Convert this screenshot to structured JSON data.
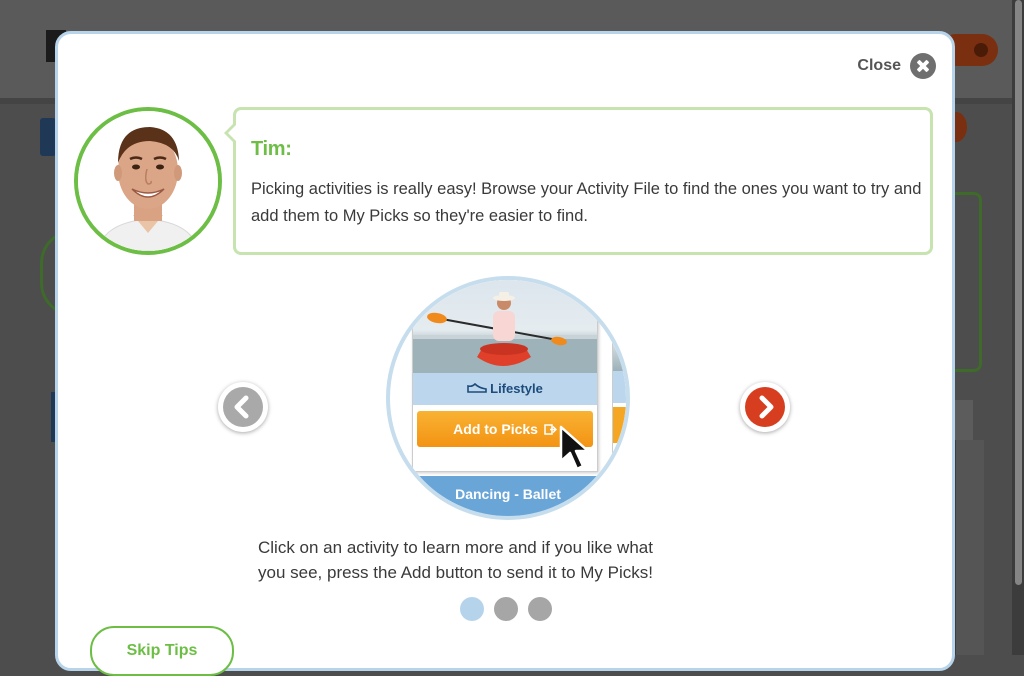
{
  "modal": {
    "close_label": "Close",
    "speaker": "Tim:",
    "speech": "Picking activities is really easy! Browse your Activity File to find the ones you want to try and add them to My Picks so they're easier to find.",
    "illustration": {
      "category_label": "Lifestyle",
      "add_button_label": "Add to Picks",
      "next_card_label": "Dancing - Ballet"
    },
    "caption_line1": "Click on an activity to learn more and if you like what",
    "caption_line2": "you see, press the Add button to send it to My Picks!",
    "pagination": {
      "total": 3,
      "active_index": 0
    },
    "skip_label": "Skip Tips"
  },
  "colors": {
    "accent_green": "#6cbe45",
    "nav_next": "#d63e1f",
    "nav_prev": "#a9a9a9",
    "add_orange": "#f5a623",
    "modal_border": "#b8d4ea"
  }
}
